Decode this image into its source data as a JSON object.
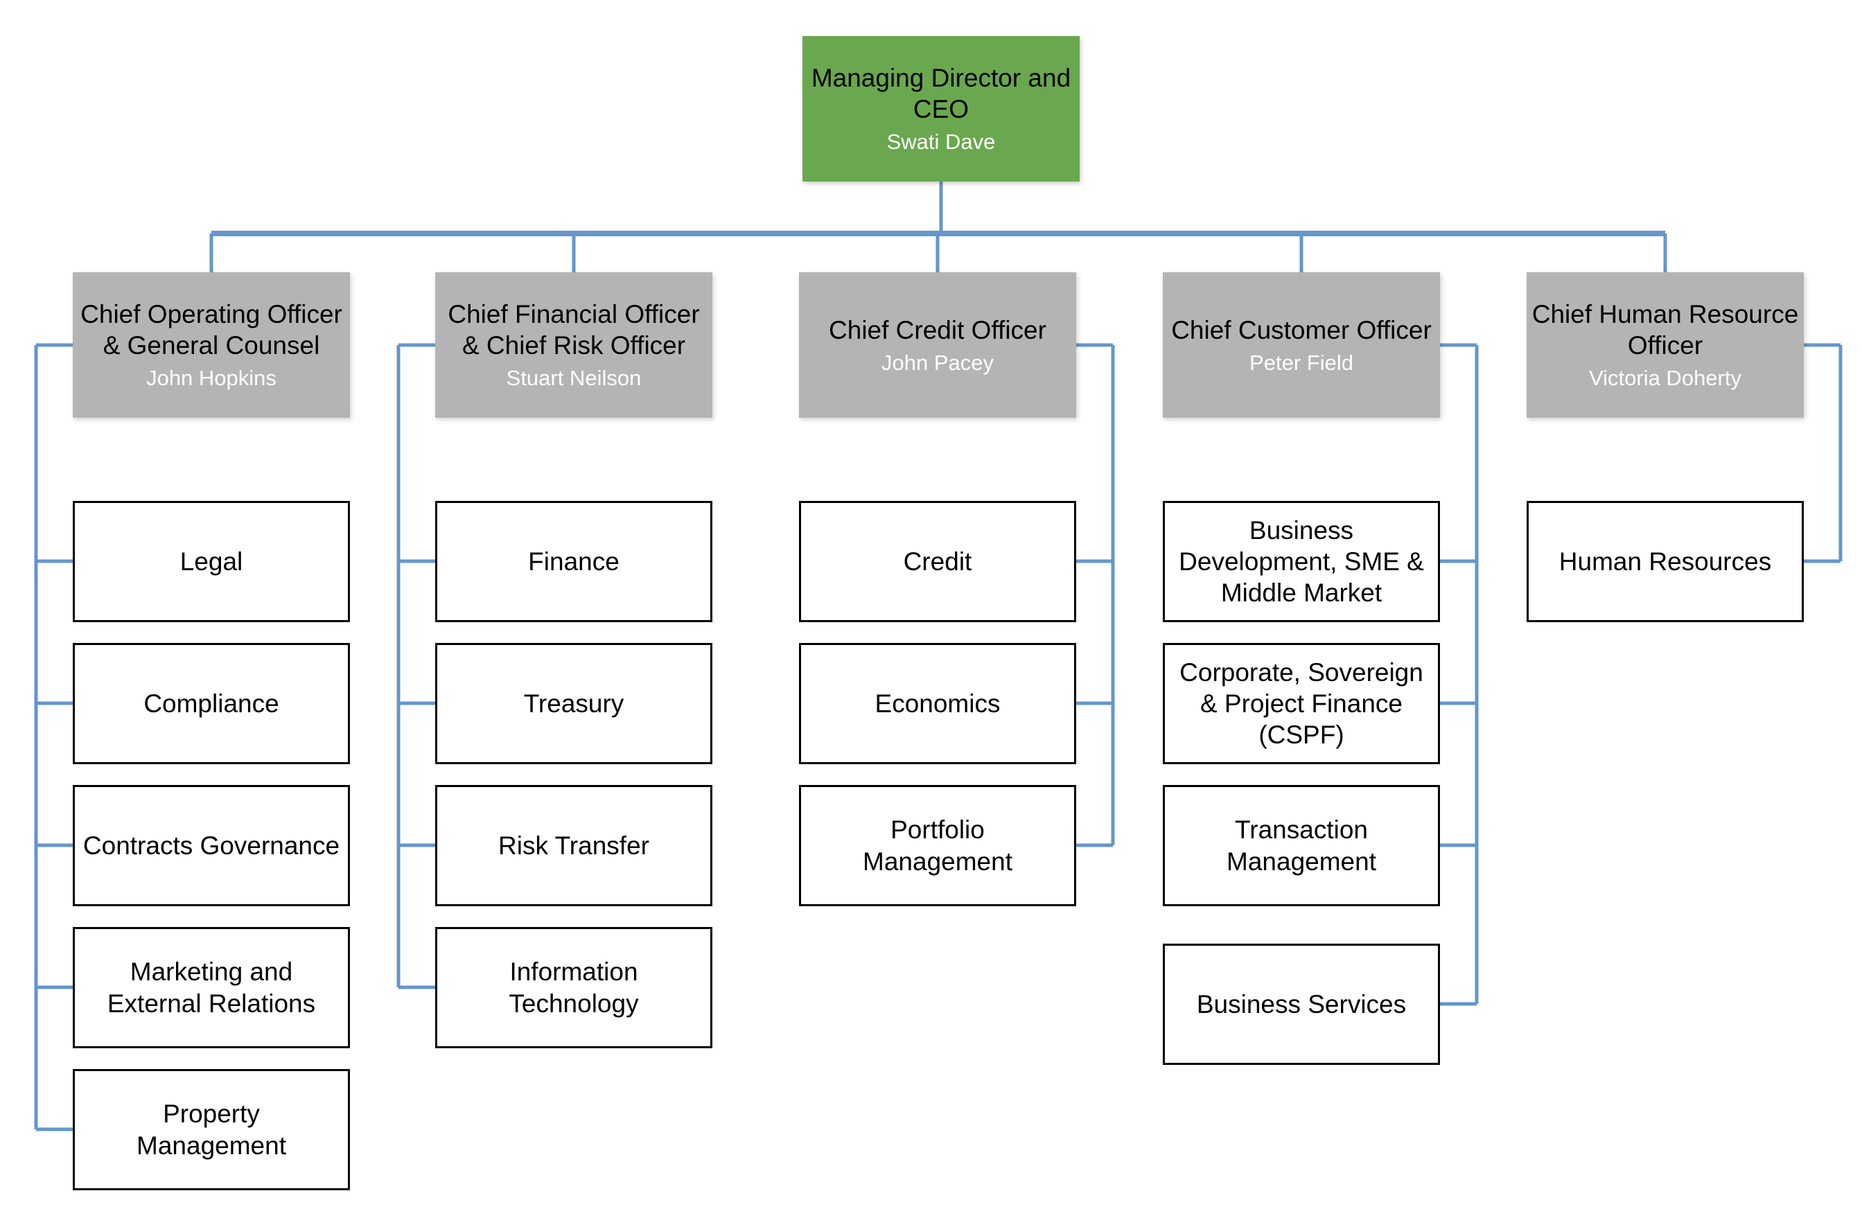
{
  "colors": {
    "root_fill": "#6aa84f",
    "exec_fill": "#b4b4b4",
    "dept_fill": "#ffffff",
    "dept_border": "#000000",
    "connector": "#6496cd",
    "title_text": "#000000",
    "person_text": "#ffffff"
  },
  "root": {
    "title": "Managing Director and CEO",
    "person": "Swati Dave"
  },
  "branches": [
    {
      "exec": {
        "title": "Chief Operating Officer\n& General Counsel",
        "person": "John Hopkins"
      },
      "children": [
        {
          "title": "Legal"
        },
        {
          "title": "Compliance"
        },
        {
          "title": "Contracts Governance"
        },
        {
          "title": "Marketing and\nExternal Relations"
        },
        {
          "title": "Property\nManagement"
        }
      ]
    },
    {
      "exec": {
        "title": "Chief Financial Officer\n& Chief Risk Officer",
        "person": "Stuart Neilson"
      },
      "children": [
        {
          "title": "Finance"
        },
        {
          "title": "Treasury"
        },
        {
          "title": "Risk Transfer"
        },
        {
          "title": "Information\nTechnology"
        }
      ]
    },
    {
      "exec": {
        "title": "Chief Credit Officer",
        "person": "John Pacey"
      },
      "children": [
        {
          "title": "Credit"
        },
        {
          "title": "Economics"
        },
        {
          "title": "Portfolio\nManagement"
        }
      ]
    },
    {
      "exec": {
        "title": "Chief Customer Officer",
        "person": "Peter Field"
      },
      "children": [
        {
          "title": "Business\nDevelopment, SME &\nMiddle Market"
        },
        {
          "title": "Corporate, Sovereign\n& Project Finance\n(CSPF)"
        },
        {
          "title": "Transaction\nManagement"
        },
        {
          "title": "Business Services"
        }
      ]
    },
    {
      "exec": {
        "title": "Chief Human Resource\nOfficer",
        "person": "Victoria Doherty"
      },
      "children": [
        {
          "title": "Human Resources"
        }
      ]
    }
  ]
}
